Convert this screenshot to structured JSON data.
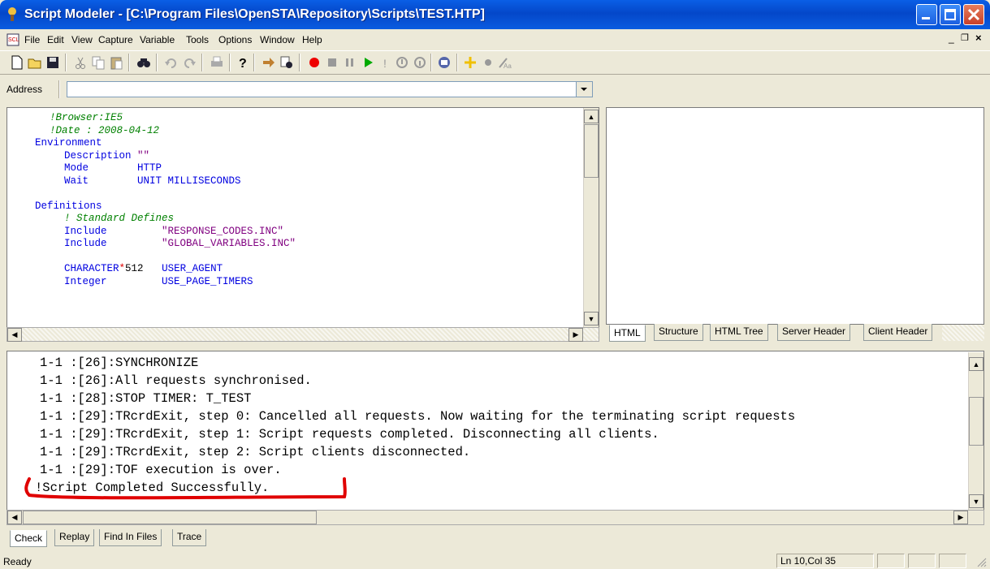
{
  "window": {
    "title": "Script Modeler - [C:\\Program Files\\OpenSTA\\Repository\\Scripts\\TEST.HTP]"
  },
  "menu": [
    "File",
    "Edit",
    "View",
    "Capture",
    "Variable",
    "Tools",
    "Options",
    "Window",
    "Help"
  ],
  "toolbar": {
    "icons": [
      "new-icon",
      "open-icon",
      "save-icon",
      "cut-icon",
      "copy-icon",
      "paste-icon",
      "find-icon",
      "undo-icon",
      "redo-icon",
      "print-icon",
      "help-icon",
      "arrow-icon",
      "binoculars-icon",
      "record-icon",
      "stop-icon",
      "pause-icon",
      "play-icon",
      "exclamation-icon",
      "step-in-icon",
      "step-out-icon",
      "compile-icon",
      "add-icon",
      "dot-icon",
      "wizard-icon"
    ]
  },
  "address": {
    "label": "Address",
    "value": ""
  },
  "editor": {
    "lines": [
      {
        "text": "!Browser:IE5",
        "indent": 2
      },
      {
        "text": "!Date : 2008-04-12",
        "indent": 2
      },
      {
        "text": "Environment",
        "indent": 0
      },
      {
        "text": "Description \"\"",
        "indent": 4
      },
      {
        "text": "Mode        HTTP",
        "indent": 4
      },
      {
        "text": "Wait        UNIT MILLISECONDS",
        "indent": 4
      },
      {
        "text": "",
        "indent": 0
      },
      {
        "text": "Definitions",
        "indent": 0
      },
      {
        "text": "! Standard Defines",
        "indent": 4
      },
      {
        "text": "Include         \"RESPONSE_CODES.INC\"",
        "indent": 4
      },
      {
        "text": "Include         \"GLOBAL_VARIABLES.INC\"",
        "indent": 4
      },
      {
        "text": "",
        "indent": 0
      },
      {
        "text": "CHARACTER*512   USER_AGENT",
        "indent": 4
      },
      {
        "text": "Integer         USE_PAGE_TIMERS",
        "indent": 4
      }
    ]
  },
  "preview_tabs": [
    "HTML",
    "Structure",
    "HTML Tree",
    "Server Header",
    "Client Header"
  ],
  "output": {
    "lines": [
      "1-1 :[26]:SYNCHRONIZE",
      "1-1 :[26]:All requests synchronised.",
      "1-1 :[28]:STOP TIMER: T_TEST",
      "1-1 :[29]:TRcrdExit, step 0: Cancelled all requests. Now waiting for the terminating script requests",
      "1-1 :[29]:TRcrdExit, step 1: Script requests completed. Disconnecting all clients.",
      "1-1 :[29]:TRcrdExit, step 2: Script clients disconnected.",
      "1-1 :[29]:TOF execution is over.",
      "!Script Completed Successfully."
    ]
  },
  "output_tabs": [
    "Check",
    "Replay",
    "Find In Files",
    "Trace"
  ],
  "status": {
    "text": "Ready",
    "position": "Ln 10,Col 35"
  },
  "colors": {
    "titlebar": "#0447c9",
    "highlight": "#e00000",
    "chrome": "#ece9d8"
  }
}
